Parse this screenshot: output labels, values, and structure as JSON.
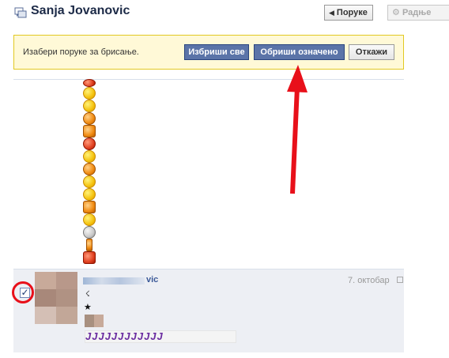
{
  "header": {
    "title": "Sanja Jovanovic",
    "messages_button": "Поруке",
    "actions_button": "Радње"
  },
  "confirm_bar": {
    "prompt": "Изабери поруке за брисање.",
    "delete_all": "Избриши све",
    "delete_selected": "Обриши означено",
    "cancel": "Откажи"
  },
  "message": {
    "sender_visible_suffix": "vic",
    "date": "7. октобар",
    "line1": "☇",
    "line2": "★",
    "j_strip": "JJJJJJJJJJJJ",
    "selected": true
  },
  "colors": {
    "accent": "#3b5998",
    "button_blue": "#5b74a8",
    "confirm_bg": "#fff9d7",
    "annotation_red": "#e8101a"
  },
  "icons": {
    "header": "messages-icon",
    "actions": "gear-icon"
  }
}
